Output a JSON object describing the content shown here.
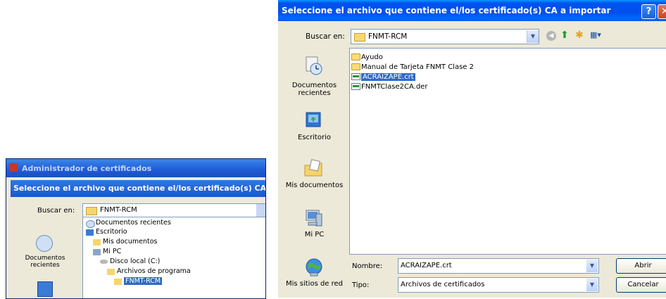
{
  "background_dialog": {
    "window_title": "Administrador de certificados",
    "dialog_title": "Seleccione el archivo que contiene el/los certificado(s) CA",
    "look_in_label": "Buscar en:",
    "look_in_value": "FNMT-RCM",
    "places": {
      "recent_label": "Documentos recientes"
    },
    "dropdown_items": [
      "Documentos recientes",
      "Escritorio",
      "Mis documentos",
      "Mi PC",
      "Disco local (C:)",
      "Archivos de programa",
      "FNMT-RCM"
    ]
  },
  "dialog": {
    "title": "Seleccione el archivo que contiene el/los certificado(s) CA a importar",
    "help_glyph": "?",
    "close_glyph": "✕",
    "look_in_label": "Buscar en:",
    "look_in_value": "FNMT-RCM",
    "view_glyph": "▦▾",
    "places": [
      {
        "label": "Documentos recientes",
        "icon": "recent-documents-icon"
      },
      {
        "label": "Escritorio",
        "icon": "desktop-icon"
      },
      {
        "label": "Mis documentos",
        "icon": "my-documents-icon"
      },
      {
        "label": "Mi PC",
        "icon": "my-computer-icon"
      },
      {
        "label": "Mis sitios de red",
        "icon": "network-places-icon"
      }
    ],
    "files": [
      {
        "name": "Ayudo",
        "type": "folder",
        "selected": false
      },
      {
        "name": "Manual de Tarjeta FNMT Clase 2",
        "type": "folder",
        "selected": false
      },
      {
        "name": "ACRAIZAPE.crt",
        "type": "certificate",
        "selected": true
      },
      {
        "name": "FNMTClase2CA.der",
        "type": "certificate",
        "selected": false
      }
    ],
    "file_name_label": "Nombre:",
    "file_name_value": "ACRAIZAPE.crt",
    "file_type_label": "Tipo:",
    "file_type_value": "Archivos de certificados",
    "open_button": "Abrir",
    "cancel_button": "Cancelar"
  },
  "colors": {
    "titlebar": "#0053ee",
    "face": "#ece9d8",
    "selection": "#316ac5"
  }
}
